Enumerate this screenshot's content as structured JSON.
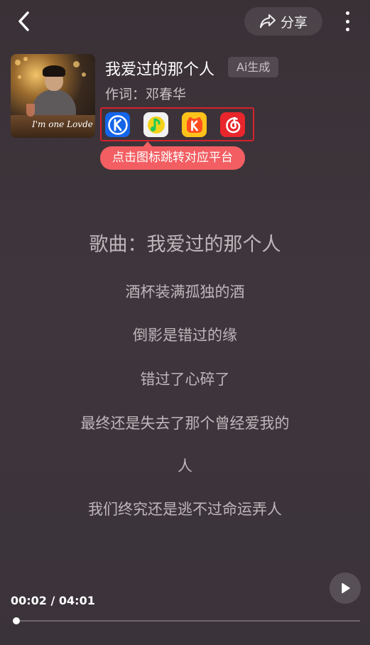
{
  "header": {
    "share_label": "分享"
  },
  "song": {
    "title": "我爱过的那个人",
    "ai_badge": "Ai生成",
    "lyricist": "作词：邓春华",
    "album_art_text": "I'm one Lovde"
  },
  "platforms": [
    {
      "name": "kugou",
      "icon": "kugou-music-icon",
      "color": "#1565e8"
    },
    {
      "name": "qq-music",
      "icon": "qq-music-icon",
      "color": "#1ec95b"
    },
    {
      "name": "kuwo",
      "icon": "kuwo-music-icon",
      "color": "#ffc21a"
    },
    {
      "name": "netease",
      "icon": "netease-cloud-music-icon",
      "color": "#e8262c"
    }
  ],
  "tooltip": "点击图标跳转对应平台",
  "lyrics": {
    "heading": "歌曲：我爱过的那个人",
    "lines": [
      "酒杯装满孤独的酒",
      "倒影是错过的缘",
      "错过了心碎了",
      "最终还是失去了那个曾经爱我的",
      "人",
      "我们终究还是逃不过命运弄人"
    ]
  },
  "player": {
    "time_display": "00:02 / 04:01",
    "progress": 0.008
  }
}
